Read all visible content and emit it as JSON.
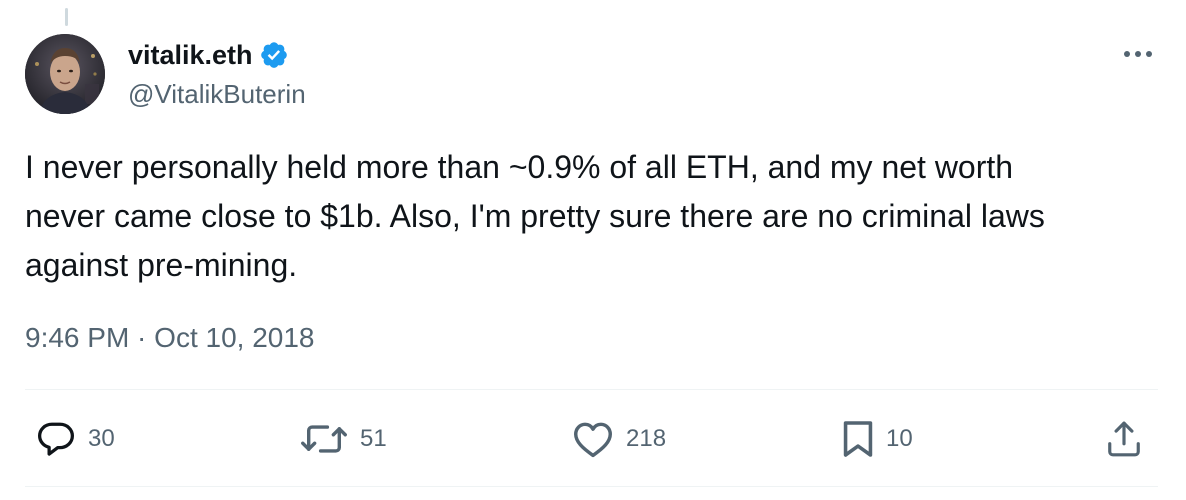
{
  "tweet": {
    "display_name": "vitalik.eth",
    "handle": "@VitalikButerin",
    "verified": true,
    "text": "I never personally held more than ~0.9% of all ETH, and my net worth\nnever came close to $1b. Also, I'm pretty sure there are no criminal laws\nagainst pre-mining.",
    "timestamp": "9:46 PM · Oct 10, 2018"
  },
  "actions": {
    "replies": "30",
    "reposts": "51",
    "likes": "218",
    "bookmarks": "10"
  },
  "icons": {
    "verified": "verified-badge-icon",
    "more": "more-horizontal-icon",
    "reply": "reply-icon",
    "repost": "repost-icon",
    "like": "heart-icon",
    "bookmark": "bookmark-icon",
    "share": "share-icon"
  },
  "colors": {
    "verified_blue": "#1d9bf0",
    "text_primary": "#0f1419",
    "text_secondary": "#536471"
  }
}
